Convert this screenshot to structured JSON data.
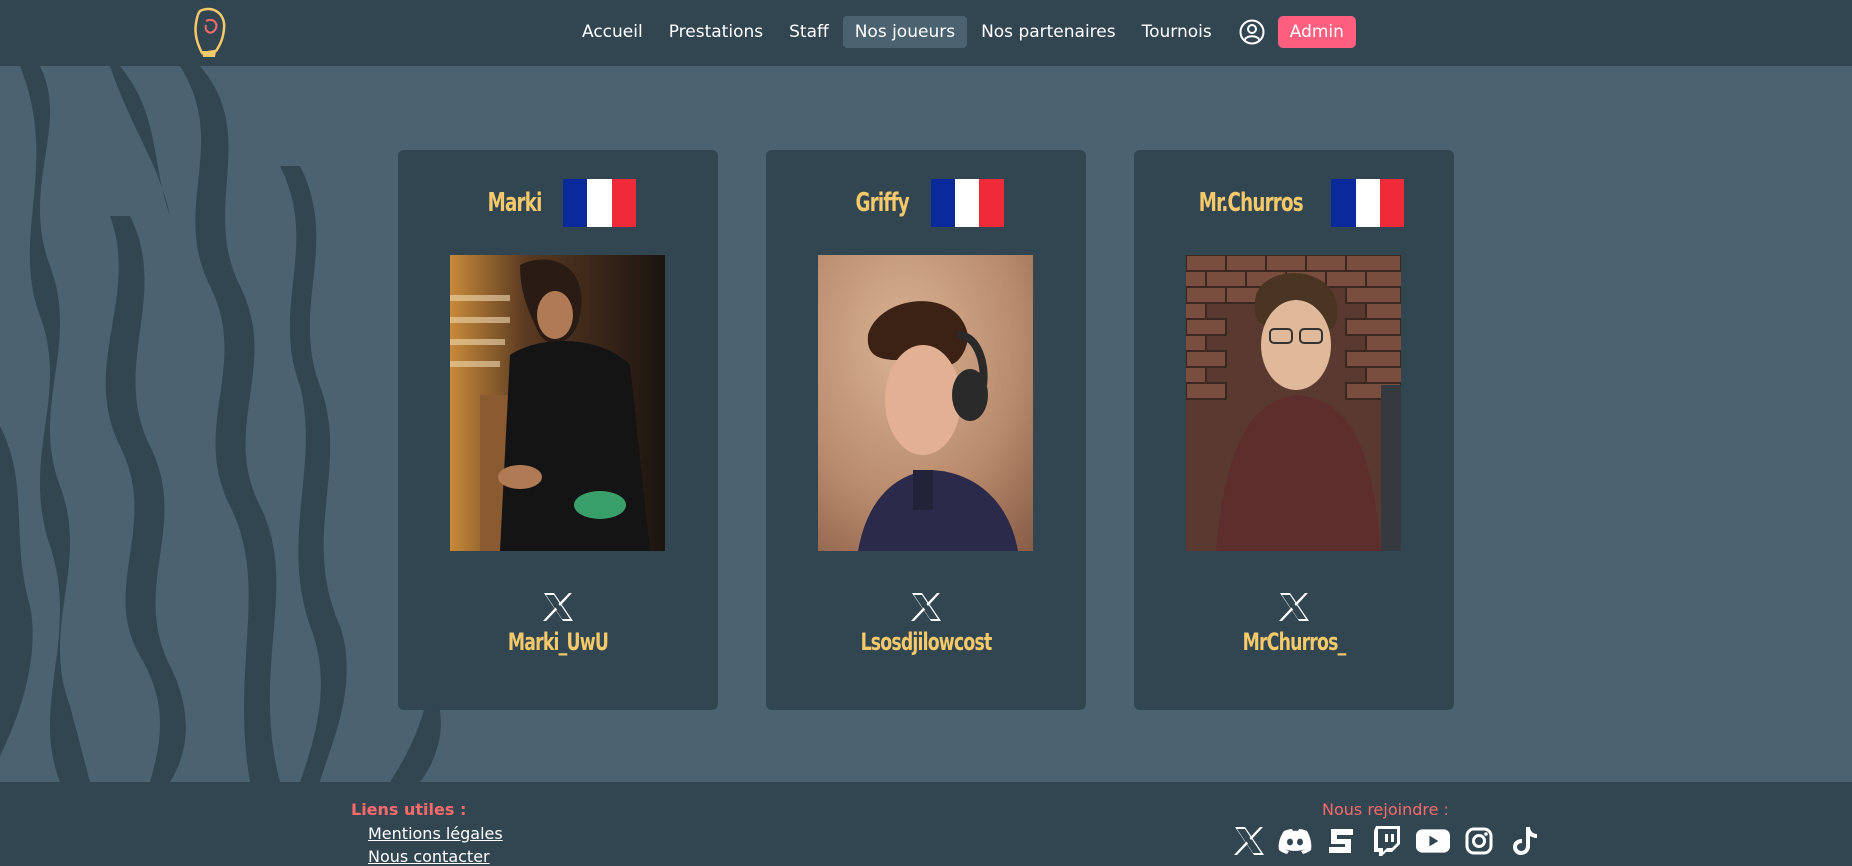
{
  "nav": {
    "items": [
      {
        "label": "Accueil",
        "active": false
      },
      {
        "label": "Prestations",
        "active": false
      },
      {
        "label": "Staff",
        "active": false
      },
      {
        "label": "Nos joueurs",
        "active": true
      },
      {
        "label": "Nos partenaires",
        "active": false
      },
      {
        "label": "Tournois",
        "active": false
      }
    ],
    "user_icon": "user-circle-icon",
    "admin_label": "Admin",
    "logo_icon": "boxing-glove-logo"
  },
  "players": [
    {
      "name": "Marki",
      "flag": "france-flag",
      "handle": "Marki_UwU",
      "social_icon": "x-icon"
    },
    {
      "name": "Griffy",
      "flag": "france-flag",
      "handle": "Lsosdjilowcost",
      "social_icon": "x-icon"
    },
    {
      "name": "Mr.Churros",
      "flag": "france-flag",
      "handle": "MrChurros_",
      "social_icon": "x-icon"
    }
  ],
  "footer": {
    "links_title": "Liens utiles :",
    "links": [
      "Mentions légales",
      "Nous contacter"
    ],
    "join_title": "Nous rejoindre :",
    "socials": [
      "x-icon",
      "discord-icon",
      "startgg-icon",
      "twitch-icon",
      "youtube-icon",
      "instagram-icon",
      "tiktok-icon"
    ]
  },
  "colors": {
    "accent": "#f6c96b",
    "admin": "#ff5f7e",
    "footer_title": "#ff6b6b",
    "bg": "#4b6270",
    "panel": "#324652"
  }
}
